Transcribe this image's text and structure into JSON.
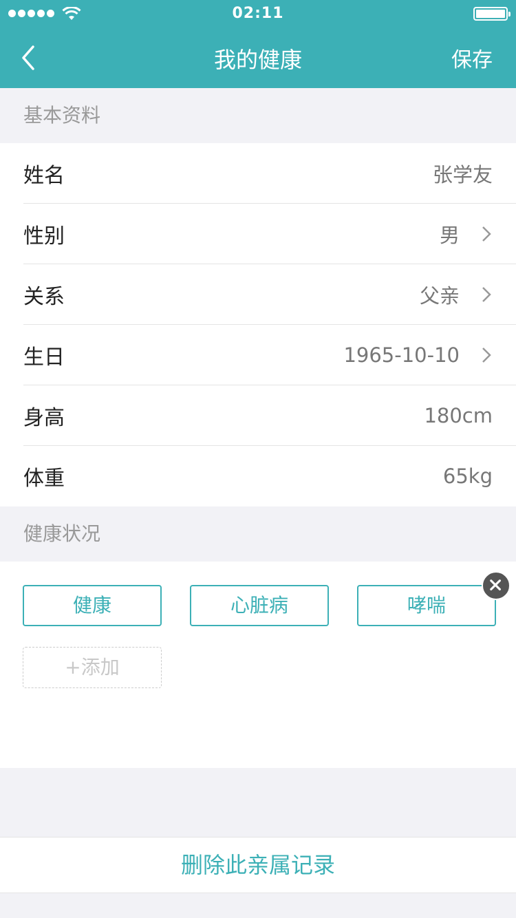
{
  "status_bar": {
    "time": "02:11",
    "signal_icon": "signal-dots-icon",
    "wifi_icon": "wifi-icon",
    "battery_icon": "battery-icon"
  },
  "nav": {
    "title": "我的健康",
    "save_label": "保存",
    "back_icon": "chevron-left-icon"
  },
  "colors": {
    "accent": "#3cb0b6",
    "background": "#f2f2f6"
  },
  "basic_info": {
    "header": "基本资料",
    "rows": [
      {
        "label": "姓名",
        "value": "张学友",
        "chevron": false
      },
      {
        "label": "性别",
        "value": "男",
        "chevron": true
      },
      {
        "label": "关系",
        "value": "父亲",
        "chevron": true
      },
      {
        "label": "生日",
        "value": "1965-10-10",
        "chevron": true
      },
      {
        "label": "身高",
        "value": "180cm",
        "chevron": false
      },
      {
        "label": "体重",
        "value": "65kg",
        "chevron": false
      }
    ]
  },
  "health": {
    "header": "健康状况",
    "tags": [
      "健康",
      "心脏病",
      "哮喘"
    ],
    "remove_icon": "close-circle-icon",
    "add_label": "+添加"
  },
  "delete_label": "删除此亲属记录"
}
